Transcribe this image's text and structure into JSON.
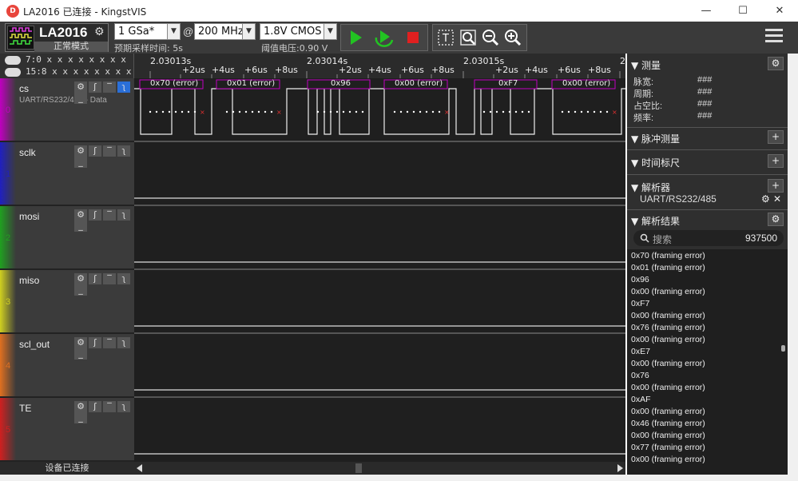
{
  "window": {
    "title": "LA2016 已连接 - KingstVIS",
    "icon_label": "D",
    "minimize": "—",
    "maximize": "☐",
    "close": "✕"
  },
  "toolbar": {
    "device_name": "LA2016",
    "device_mode": "正常模式",
    "sample_rate": "1 GSa*",
    "at": "@",
    "sample_depth": "200 MHz",
    "threshold_type": "1.8V CMOS",
    "sample_time_label": "预期采样时间: 5s",
    "threshold_label": "阈值电压:0.90 V"
  },
  "ruler": {
    "bit_rows": [
      {
        "label": "7:0",
        "bits": "x x x x x x x x"
      },
      {
        "label": "15:8",
        "bits": "x x x x x x x x"
      }
    ],
    "major": [
      "2.03013s",
      "2.03014s",
      "2.03015s",
      "2"
    ],
    "minor": [
      "+2us",
      "+4us",
      "+6us",
      "+8us",
      "+2us",
      "+4us",
      "+6us",
      "+8us",
      "+2us",
      "+4us",
      "+6us",
      "+8us"
    ]
  },
  "channels": [
    {
      "name": "cs",
      "num": "0",
      "color": "#c000c0",
      "sub": "UART/RS232/485 - Data"
    },
    {
      "name": "sclk",
      "num": "1",
      "color": "#2020c0",
      "sub": ""
    },
    {
      "name": "mosi",
      "num": "2",
      "color": "#20a020",
      "sub": ""
    },
    {
      "name": "miso",
      "num": "3",
      "color": "#d0d020",
      "sub": ""
    },
    {
      "name": "scl_out",
      "num": "4",
      "color": "#e07020",
      "sub": ""
    },
    {
      "name": "TE",
      "num": "5",
      "color": "#d02020",
      "sub": ""
    }
  ],
  "channel_icons": [
    "⚙",
    "ʃ",
    "‾",
    "ʅ",
    "_"
  ],
  "decode_labels": [
    "0x70 (error)",
    "0x01 (error)",
    "0x96",
    "0x00 (error)",
    "0xF7",
    "0x00 (error)"
  ],
  "status": "设备已连接",
  "panel": {
    "measure_title": "测量",
    "measure_items": [
      {
        "k": "脉宽:",
        "v": "###"
      },
      {
        "k": "周期:",
        "v": "###"
      },
      {
        "k": "占空比:",
        "v": "###"
      },
      {
        "k": "频率:",
        "v": "###"
      }
    ],
    "pulse_title": "脉冲测量",
    "timer_title": "时间标尺",
    "analyzer_title": "解析器",
    "analyzer_item": "UART/RS232/485",
    "results_title": "解析结果",
    "search_placeholder": "搜索",
    "search_count": "937500",
    "results": [
      "0x70 (framing error)",
      "0x01 (framing error)",
      "0x96",
      "0x00 (framing error)",
      "0xF7",
      "0x00 (framing error)",
      "0x76 (framing error)",
      "0x00 (framing error)",
      "0xE7",
      "0x00 (framing error)",
      "0x76",
      "0x00 (framing error)",
      "0xAF",
      "0x00 (framing error)",
      "0x46 (framing error)",
      "0x00 (framing error)",
      "0x77 (framing error)",
      "0x00 (framing error)"
    ]
  },
  "colors": {
    "run_green": "#22c322",
    "stop_red": "#e02020",
    "decode_border": "#c000c0"
  }
}
